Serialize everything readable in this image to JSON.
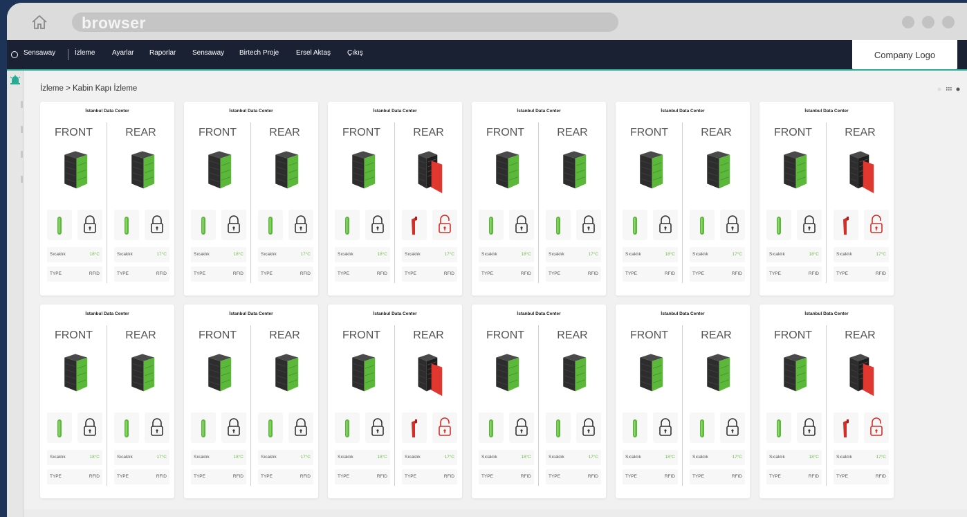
{
  "browser": {
    "url_text": "browser"
  },
  "nav": {
    "brand": "Sensaway",
    "items": [
      "İzleme",
      "Ayarlar",
      "Raporlar",
      "Sensaway",
      "Birtech Proje",
      "Ersel Aktaş",
      "Çıkış"
    ]
  },
  "company_logo": "Company Logo",
  "breadcrumb": "İzleme > Kabin Kapı İzleme",
  "colors": {
    "accent": "#27ab93",
    "nav_bg": "#1a2133",
    "door_ok": "#5cb83a",
    "door_open": "#e0382e",
    "temp": "#6dbd4b"
  },
  "labels": {
    "front": "FRONT",
    "rear": "REAR",
    "temp_label": "Sıcaklık",
    "type": "TYPE",
    "rfid": "RFID"
  },
  "cards": [
    {
      "title": "İstanbul Data Center",
      "front": {
        "door": "closed",
        "temp": "18°C"
      },
      "rear": {
        "door": "closed",
        "temp": "17°C"
      }
    },
    {
      "title": "İstanbul Data Center",
      "front": {
        "door": "closed",
        "temp": "18°C"
      },
      "rear": {
        "door": "closed",
        "temp": "17°C"
      }
    },
    {
      "title": "İstanbul Data Center",
      "front": {
        "door": "closed",
        "temp": "18°C"
      },
      "rear": {
        "door": "open",
        "temp": "17°C"
      }
    },
    {
      "title": "İstanbul Data Center",
      "front": {
        "door": "closed",
        "temp": "18°C"
      },
      "rear": {
        "door": "closed",
        "temp": "17°C"
      }
    },
    {
      "title": "İstanbul Data Center",
      "front": {
        "door": "closed",
        "temp": "18°C"
      },
      "rear": {
        "door": "closed",
        "temp": "17°C"
      }
    },
    {
      "title": "İstanbul Data Center",
      "front": {
        "door": "closed",
        "temp": "18°C"
      },
      "rear": {
        "door": "open",
        "temp": "17°C"
      }
    },
    {
      "title": "İstanbul Data Center",
      "front": {
        "door": "closed",
        "temp": "18°C"
      },
      "rear": {
        "door": "closed",
        "temp": "17°C"
      }
    },
    {
      "title": "İstanbul Data Center",
      "front": {
        "door": "closed",
        "temp": "18°C"
      },
      "rear": {
        "door": "closed",
        "temp": "17°C"
      }
    },
    {
      "title": "İstanbul Data Center",
      "front": {
        "door": "closed",
        "temp": "18°C"
      },
      "rear": {
        "door": "open",
        "temp": "17°C"
      }
    },
    {
      "title": "İstanbul Data Center",
      "front": {
        "door": "closed",
        "temp": "18°C"
      },
      "rear": {
        "door": "closed",
        "temp": "17°C"
      }
    },
    {
      "title": "İstanbul Data Center",
      "front": {
        "door": "closed",
        "temp": "18°C"
      },
      "rear": {
        "door": "closed",
        "temp": "17°C"
      }
    },
    {
      "title": "İstanbul Data Center",
      "front": {
        "door": "closed",
        "temp": "18°C"
      },
      "rear": {
        "door": "open",
        "temp": "17°C"
      }
    }
  ]
}
